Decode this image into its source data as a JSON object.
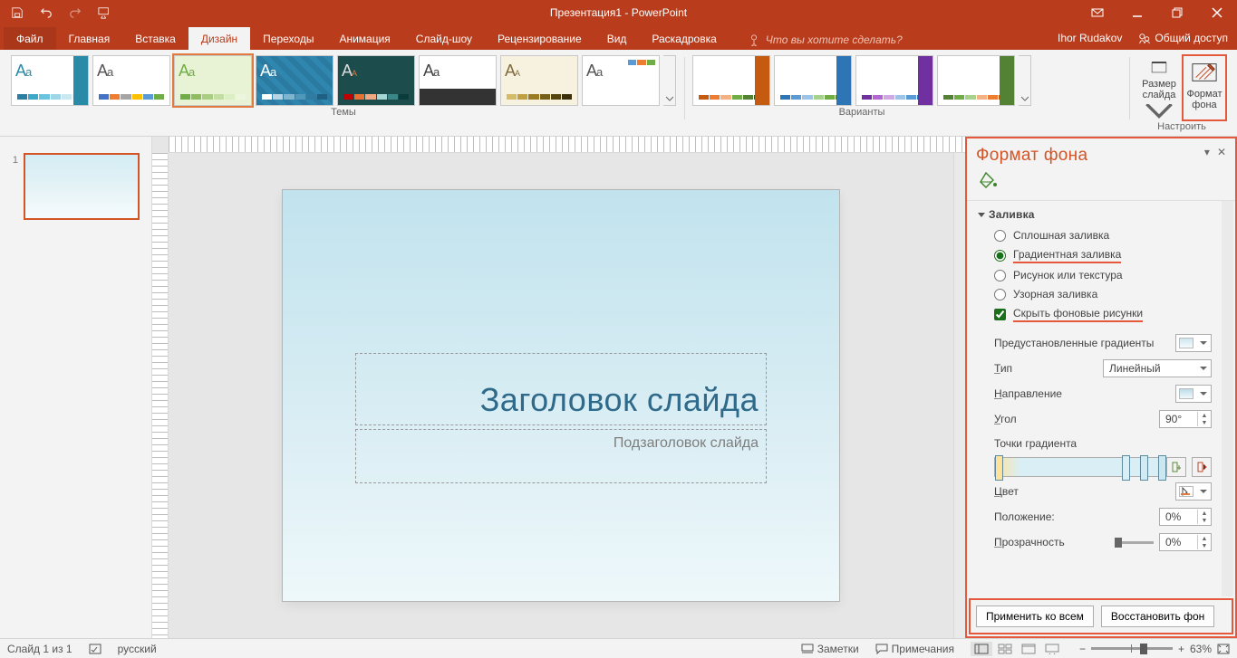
{
  "title": "Презентация1 - PowerPoint",
  "account": {
    "user": "Ihor Rudakov",
    "share": "Общий доступ"
  },
  "tabs": {
    "file": "Файл",
    "items": [
      "Главная",
      "Вставка",
      "Дизайн",
      "Переходы",
      "Анимация",
      "Слайд-шоу",
      "Рецензирование",
      "Вид",
      "Раскадровка"
    ],
    "active_index": 2,
    "tell_me": "Что вы хотите сделать?"
  },
  "ribbon": {
    "themes_label": "Темы",
    "variants_label": "Варианты",
    "customize_label": "Настроить",
    "size_btn": "Размер\nслайда",
    "format_btn": "Формат\nфона"
  },
  "slide": {
    "number": "1",
    "title_placeholder": "Заголовок слайда",
    "subtitle_placeholder": "Подзаголовок слайда"
  },
  "panel": {
    "title": "Формат фона",
    "section_fill": "Заливка",
    "opt_solid": "Сплошная заливка",
    "opt_gradient": "Градиентная заливка",
    "opt_picture": "Рисунок или текстура",
    "opt_pattern": "Узорная заливка",
    "opt_hide": "Скрыть фоновые рисунки",
    "preset": "Предустановленные градиенты",
    "type_label": "Тип",
    "type_value": "Линейный",
    "direction": "Направление",
    "angle_label": "Угол",
    "angle_value": "90°",
    "stops_label": "Точки градиента",
    "color_label": "Цвет",
    "position_label": "Положение:",
    "position_value": "0%",
    "transparency_label": "Прозрачность",
    "transparency_value": "0%",
    "apply_all": "Применить ко всем",
    "reset": "Восстановить фон"
  },
  "status": {
    "slide_of": "Слайд 1 из 1",
    "lang": "русский",
    "notes": "Заметки",
    "comments": "Примечания",
    "zoom": "63%"
  }
}
